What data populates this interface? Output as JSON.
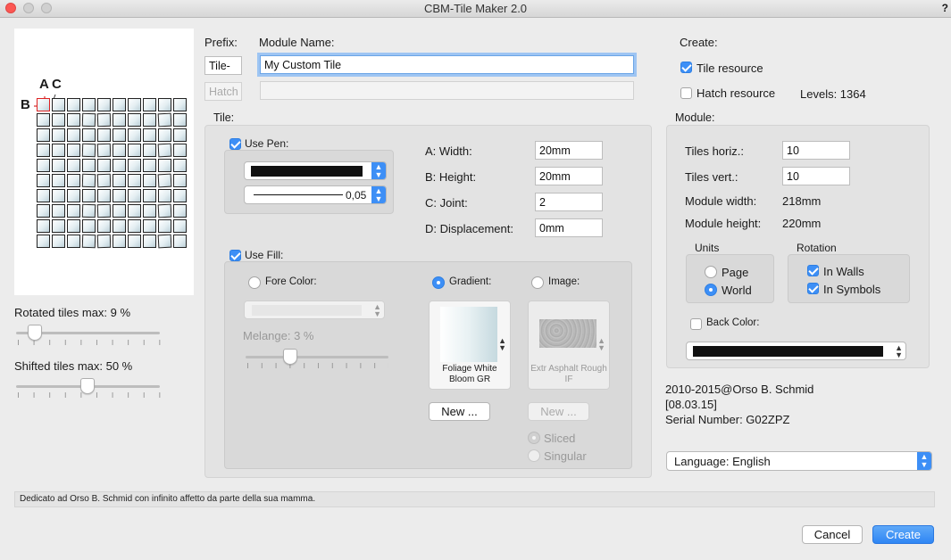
{
  "window": {
    "title": "CBM-Tile Maker 2.0",
    "help": "?"
  },
  "preview": {
    "label_a": "A",
    "label_c": "C",
    "label_b": "B"
  },
  "sliders": {
    "rotated_label": "Rotated tiles max: 9 %",
    "rotated_value": 9,
    "shifted_label": "Shifted tiles max: 50 %",
    "shifted_value": 50
  },
  "naming": {
    "prefix_label": "Prefix:",
    "module_name_label": "Module Name:",
    "tile_prefix": "Tile-",
    "hatch_prefix": "Hatch-",
    "module_name": "My Custom Tile",
    "hatch_name": ""
  },
  "create": {
    "label": "Create:",
    "tile_resource": "Tile resource",
    "tile_resource_checked": true,
    "hatch_resource": "Hatch resource",
    "hatch_resource_checked": false,
    "levels": "Levels: 1364"
  },
  "tile": {
    "section": "Tile:",
    "use_pen": "Use Pen:",
    "use_pen_checked": true,
    "pen_weight": "0,05",
    "width_label": "A: Width:",
    "width": "20mm",
    "height_label": "B: Height:",
    "height": "20mm",
    "joint_label": "C: Joint:",
    "joint": "2",
    "displacement_label": "D: Displacement:",
    "displacement": "0mm",
    "use_fill": "Use Fill:",
    "use_fill_checked": true,
    "fore_color": "Fore Color:",
    "melange": "Melange: 3 %",
    "melange_value": 3,
    "gradient": "Gradient:",
    "image": "Image:",
    "gradient_name": "Foliage White Bloom GR",
    "image_name": "Extr Asphalt Rough IF",
    "new_label": "New ...",
    "sliced": "Sliced",
    "singular": "Singular"
  },
  "module": {
    "section": "Module:",
    "tiles_horiz_label": "Tiles horiz.:",
    "tiles_horiz": "10",
    "tiles_vert_label": "Tiles vert.:",
    "tiles_vert": "10",
    "width_label": "Module width:",
    "width": "218mm",
    "height_label": "Module height:",
    "height": "220mm",
    "units_label": "Units",
    "page": "Page",
    "world": "World",
    "rotation_label": "Rotation",
    "in_walls": "In Walls",
    "in_symbols": "In Symbols",
    "back_color": "Back Color:"
  },
  "credits": {
    "line1": "2010-2015@Orso B. Schmid",
    "line2": "[08.03.15]",
    "line3": "Serial Number: G02ZPZ"
  },
  "language": "Language: English",
  "status": "Dedicato ad Orso B. Schmid con infinito affetto da parte della sua mamma.",
  "buttons": {
    "cancel": "Cancel",
    "create": "Create"
  },
  "colors": {
    "accent": "#3d8ff6",
    "close": "#fc5753"
  }
}
